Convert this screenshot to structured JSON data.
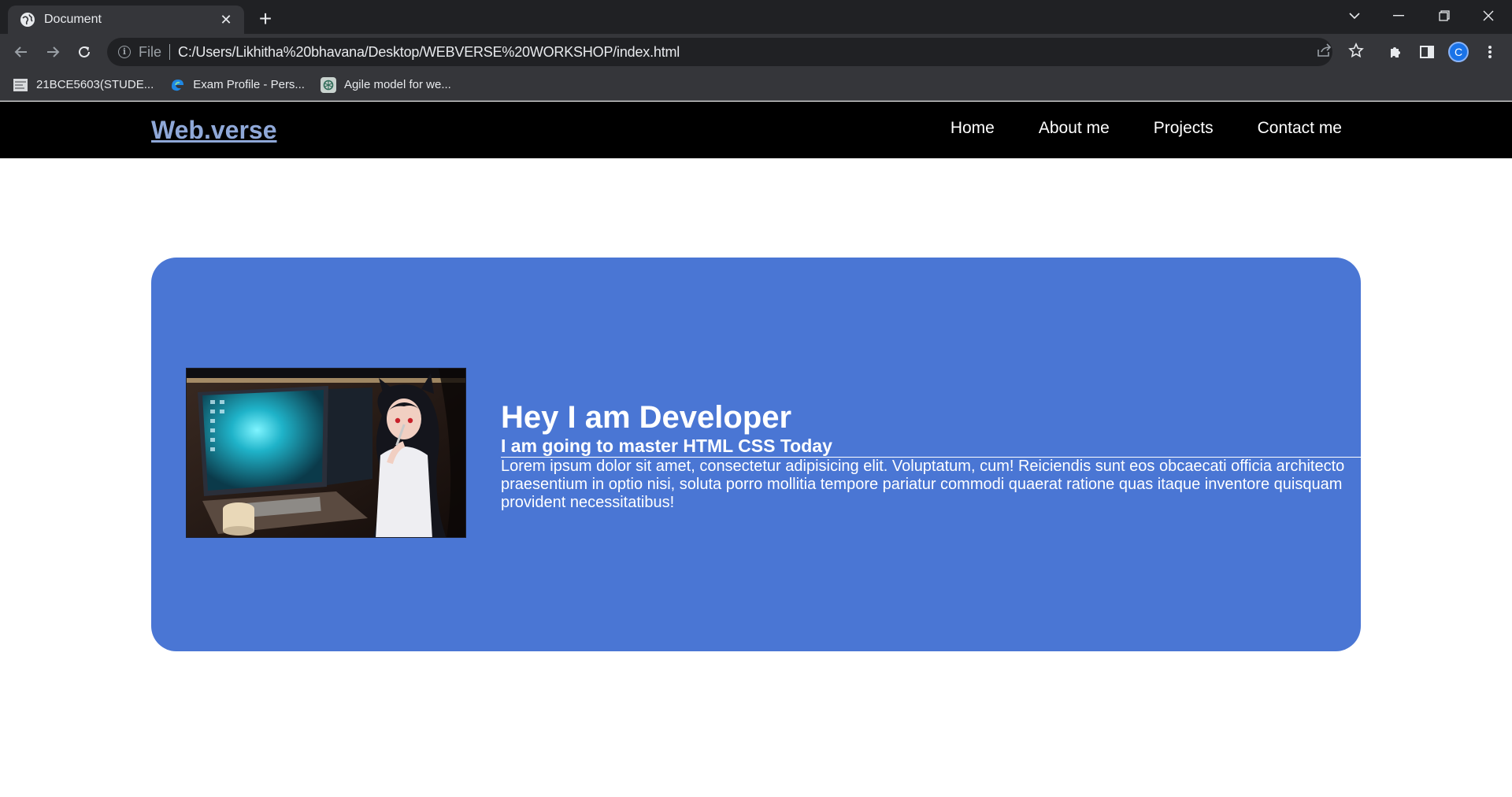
{
  "browser": {
    "tab_title": "Document",
    "address": {
      "scheme_label": "File",
      "url": "C:/Users/Likhitha%20bhavana/Desktop/WEBVERSE%20WORKSHOP/index.html"
    },
    "profile_initial": "C",
    "bookmarks": [
      {
        "label": "21BCE5603(STUDE...",
        "icon": "document-icon"
      },
      {
        "label": "Exam Profile - Pers...",
        "icon": "edge-icon"
      },
      {
        "label": "Agile model for we...",
        "icon": "chatgpt-icon"
      }
    ]
  },
  "site": {
    "logo": "Web.verse",
    "nav": [
      "Home",
      "About me",
      "Projects",
      "Contact me"
    ],
    "hero": {
      "heading": "Hey I am Developer",
      "subheading": "I am going to master HTML CSS Today",
      "body": "Lorem ipsum dolor sit amet, consectetur adipisicing elit. Voluptatum, cum! Reiciendis sunt eos obcaecati officia architecto praesentium in optio nisi, soluta porro mollitia tempore pariatur commodi quaerat ratione quas itaque inventore quisquam provident necessitatibus!",
      "image": "anime-girl-at-computer-illustration"
    }
  },
  "colors": {
    "hero_bg": "#4a76d4",
    "nav_bg": "#000000",
    "logo": "#8fa8d8"
  }
}
